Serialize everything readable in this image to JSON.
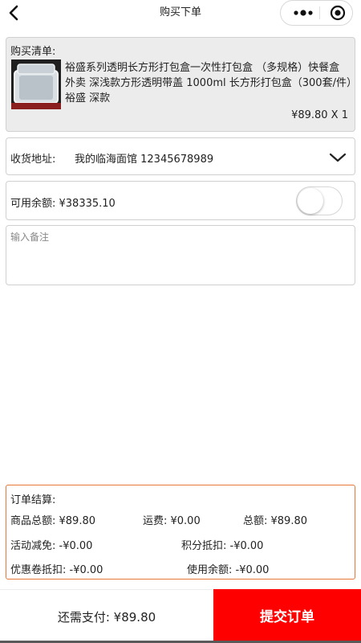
{
  "nav": {
    "title": "购买下单",
    "back_icon": "chevron-left-icon",
    "more_icon": "more-dots-icon",
    "close_icon": "target-close-icon"
  },
  "cart": {
    "label": "购买清单:",
    "product_image_icon": "food-container-image",
    "product_name": "裕盛系列透明长方形打包盒一次性打包盒 （多规格）快餐盒 外卖 深浅款方形透明带盖 1000ml 长方形打包盒（300套/件）裕盛 深款",
    "price_qty": "¥89.80 X 1"
  },
  "address": {
    "label": "收货地址:",
    "value": "我的临海面馆 12345678989",
    "chevron_icon": "chevron-down-icon"
  },
  "balance": {
    "label": "可用余额: ¥38335.10",
    "toggle_on": false
  },
  "note": {
    "placeholder": "输入备注"
  },
  "summary": {
    "title": "订单结算:",
    "goods_total": "商品总额: ¥89.80",
    "shipping": "运费: ¥0.00",
    "total": "总额: ¥89.80",
    "promo": "活动减免: -¥0.00",
    "points": "积分抵扣: -¥0.00",
    "coupon": "优惠卷抵扣: -¥0.00",
    "balance_used": "使用余额: -¥0.00",
    "border_color": "#e8773a"
  },
  "footer": {
    "due": "还需支付: ¥89.80",
    "submit_label": "提交订单",
    "submit_color": "#ff0000"
  }
}
